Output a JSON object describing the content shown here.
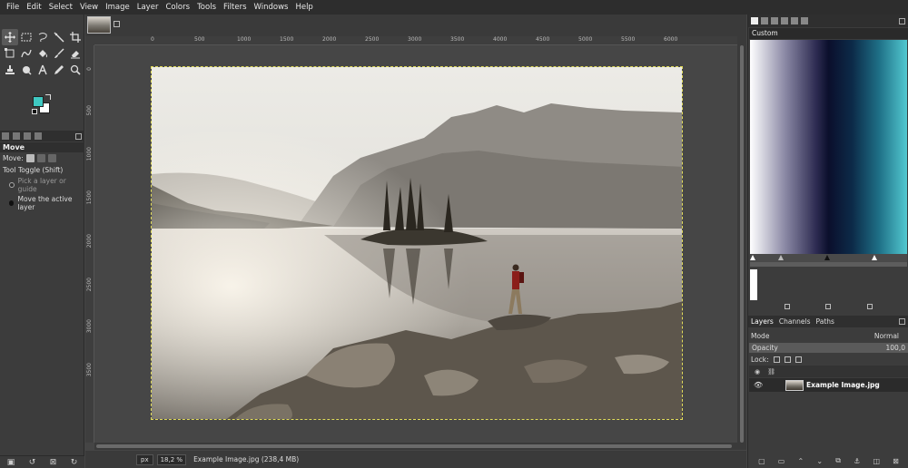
{
  "menu": [
    "File",
    "Edit",
    "Select",
    "View",
    "Image",
    "Layer",
    "Colors",
    "Tools",
    "Filters",
    "Windows",
    "Help"
  ],
  "tools": [
    "move-tool",
    "rect-select-tool",
    "free-select-tool",
    "fuzzy-select-tool",
    "crop-tool",
    "unified-transform-tool",
    "warp-tool",
    "paint-bucket-tool",
    "paintbrush-tool",
    "eraser-tool",
    "clone-tool",
    "smudge-tool",
    "text-tool",
    "color-picker-tool",
    "zoom-tool"
  ],
  "colors": {
    "foreground": "#3fc9c2",
    "background": "#ffffff"
  },
  "tool_options": {
    "title": "Move",
    "move_label": "Move:",
    "toggle_label": "Tool Toggle  (Shift)",
    "option1": "Pick a layer or guide",
    "option2": "Move the active layer"
  },
  "ruler": {
    "h_ticks": [
      "0",
      "500",
      "1000",
      "1500",
      "2000",
      "2500",
      "3000",
      "3500",
      "4000",
      "4500",
      "5000",
      "5500",
      "6000"
    ],
    "v_ticks": [
      "0",
      "500",
      "1000",
      "1500",
      "2000",
      "2500",
      "3000",
      "3500"
    ]
  },
  "status": {
    "unit": "px",
    "zoom": "18,2 %",
    "text": "Example Image.jpg (238,4 MB)"
  },
  "gradient": {
    "name": "Custom"
  },
  "layers": {
    "tabs": [
      "Layers",
      "Channels",
      "Paths"
    ],
    "mode_label": "Mode",
    "mode_value": "Normal",
    "opacity_label": "Opacity",
    "opacity_value": "100,0",
    "lock_label": "Lock:",
    "items": [
      {
        "name": "Example Image.jpg"
      }
    ]
  },
  "left_bottom_icons": [
    "save-icon",
    "restore-icon",
    "delete-icon",
    "reset-icon"
  ],
  "layer_buttons": [
    "new-layer-icon",
    "new-group-icon",
    "raise-icon",
    "lower-icon",
    "duplicate-icon",
    "anchor-icon",
    "mask-icon",
    "delete-icon"
  ]
}
